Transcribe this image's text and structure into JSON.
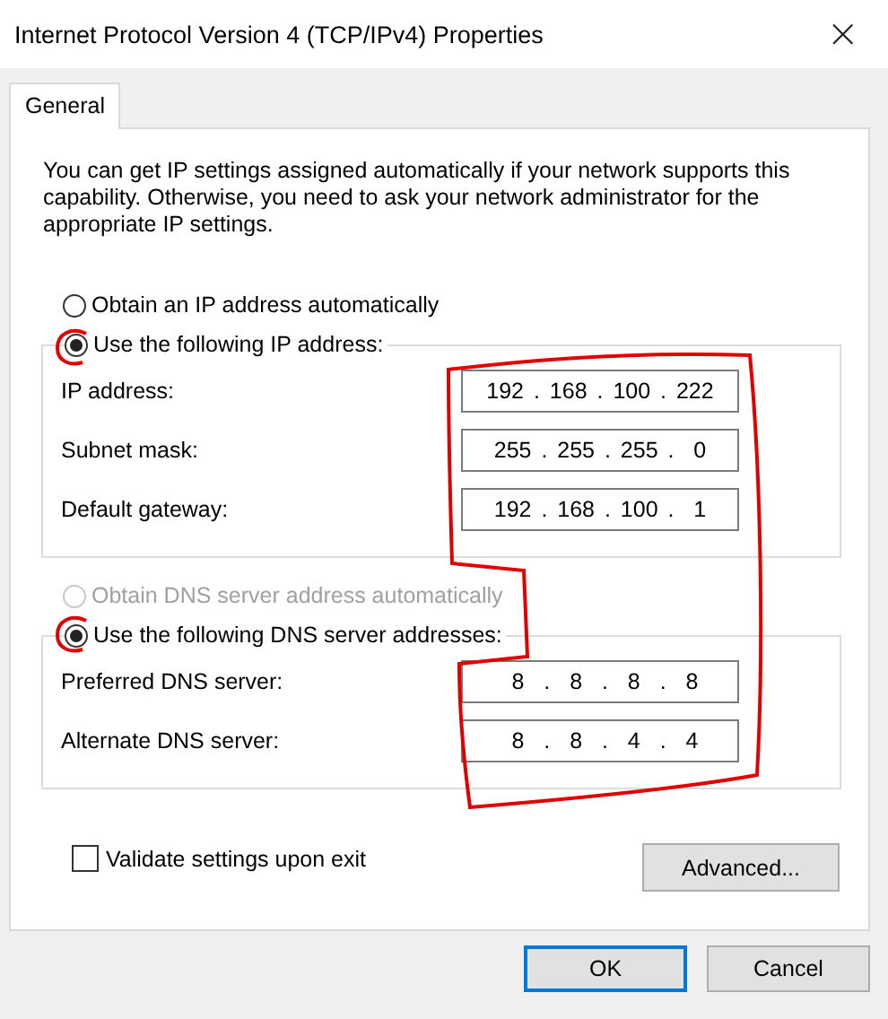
{
  "window": {
    "title": "Internet Protocol Version 4 (TCP/IPv4) Properties",
    "close": "×"
  },
  "tabs": [
    {
      "label": "General",
      "selected": true
    }
  ],
  "intro": "You can get IP settings assigned automatically if your network supports this capability. Otherwise, you need to ask your network administrator for the appropriate IP settings.",
  "ip": {
    "auto": {
      "label": "Obtain an IP address automatically",
      "selected": false,
      "disabled": false
    },
    "manual": {
      "label": "Use the following IP address:",
      "selected": true,
      "disabled": false
    },
    "fields": [
      {
        "label": "IP address:",
        "value": "192 . 168 . 100 . 222"
      },
      {
        "label": "Subnet mask:",
        "value": "255 . 255 . 255 .  0"
      },
      {
        "label": "Default gateway:",
        "value": "192 . 168 . 100 .  1"
      }
    ]
  },
  "dns": {
    "auto": {
      "label": "Obtain DNS server address automatically",
      "selected": false,
      "disabled": true
    },
    "manual": {
      "label": "Use the following DNS server addresses:",
      "selected": true,
      "disabled": false
    },
    "fields": [
      {
        "label": "Preferred DNS server:",
        "value": " 8  .  8  .  8  .  8"
      },
      {
        "label": "Alternate DNS server:",
        "value": " 8  .  8  .  4  .  4"
      }
    ]
  },
  "validate": {
    "label": "Validate settings upon exit",
    "checked": false
  },
  "advanced": "Advanced...",
  "buttons": [
    {
      "label": "OK",
      "default": true
    },
    {
      "label": "Cancel",
      "default": false
    }
  ]
}
